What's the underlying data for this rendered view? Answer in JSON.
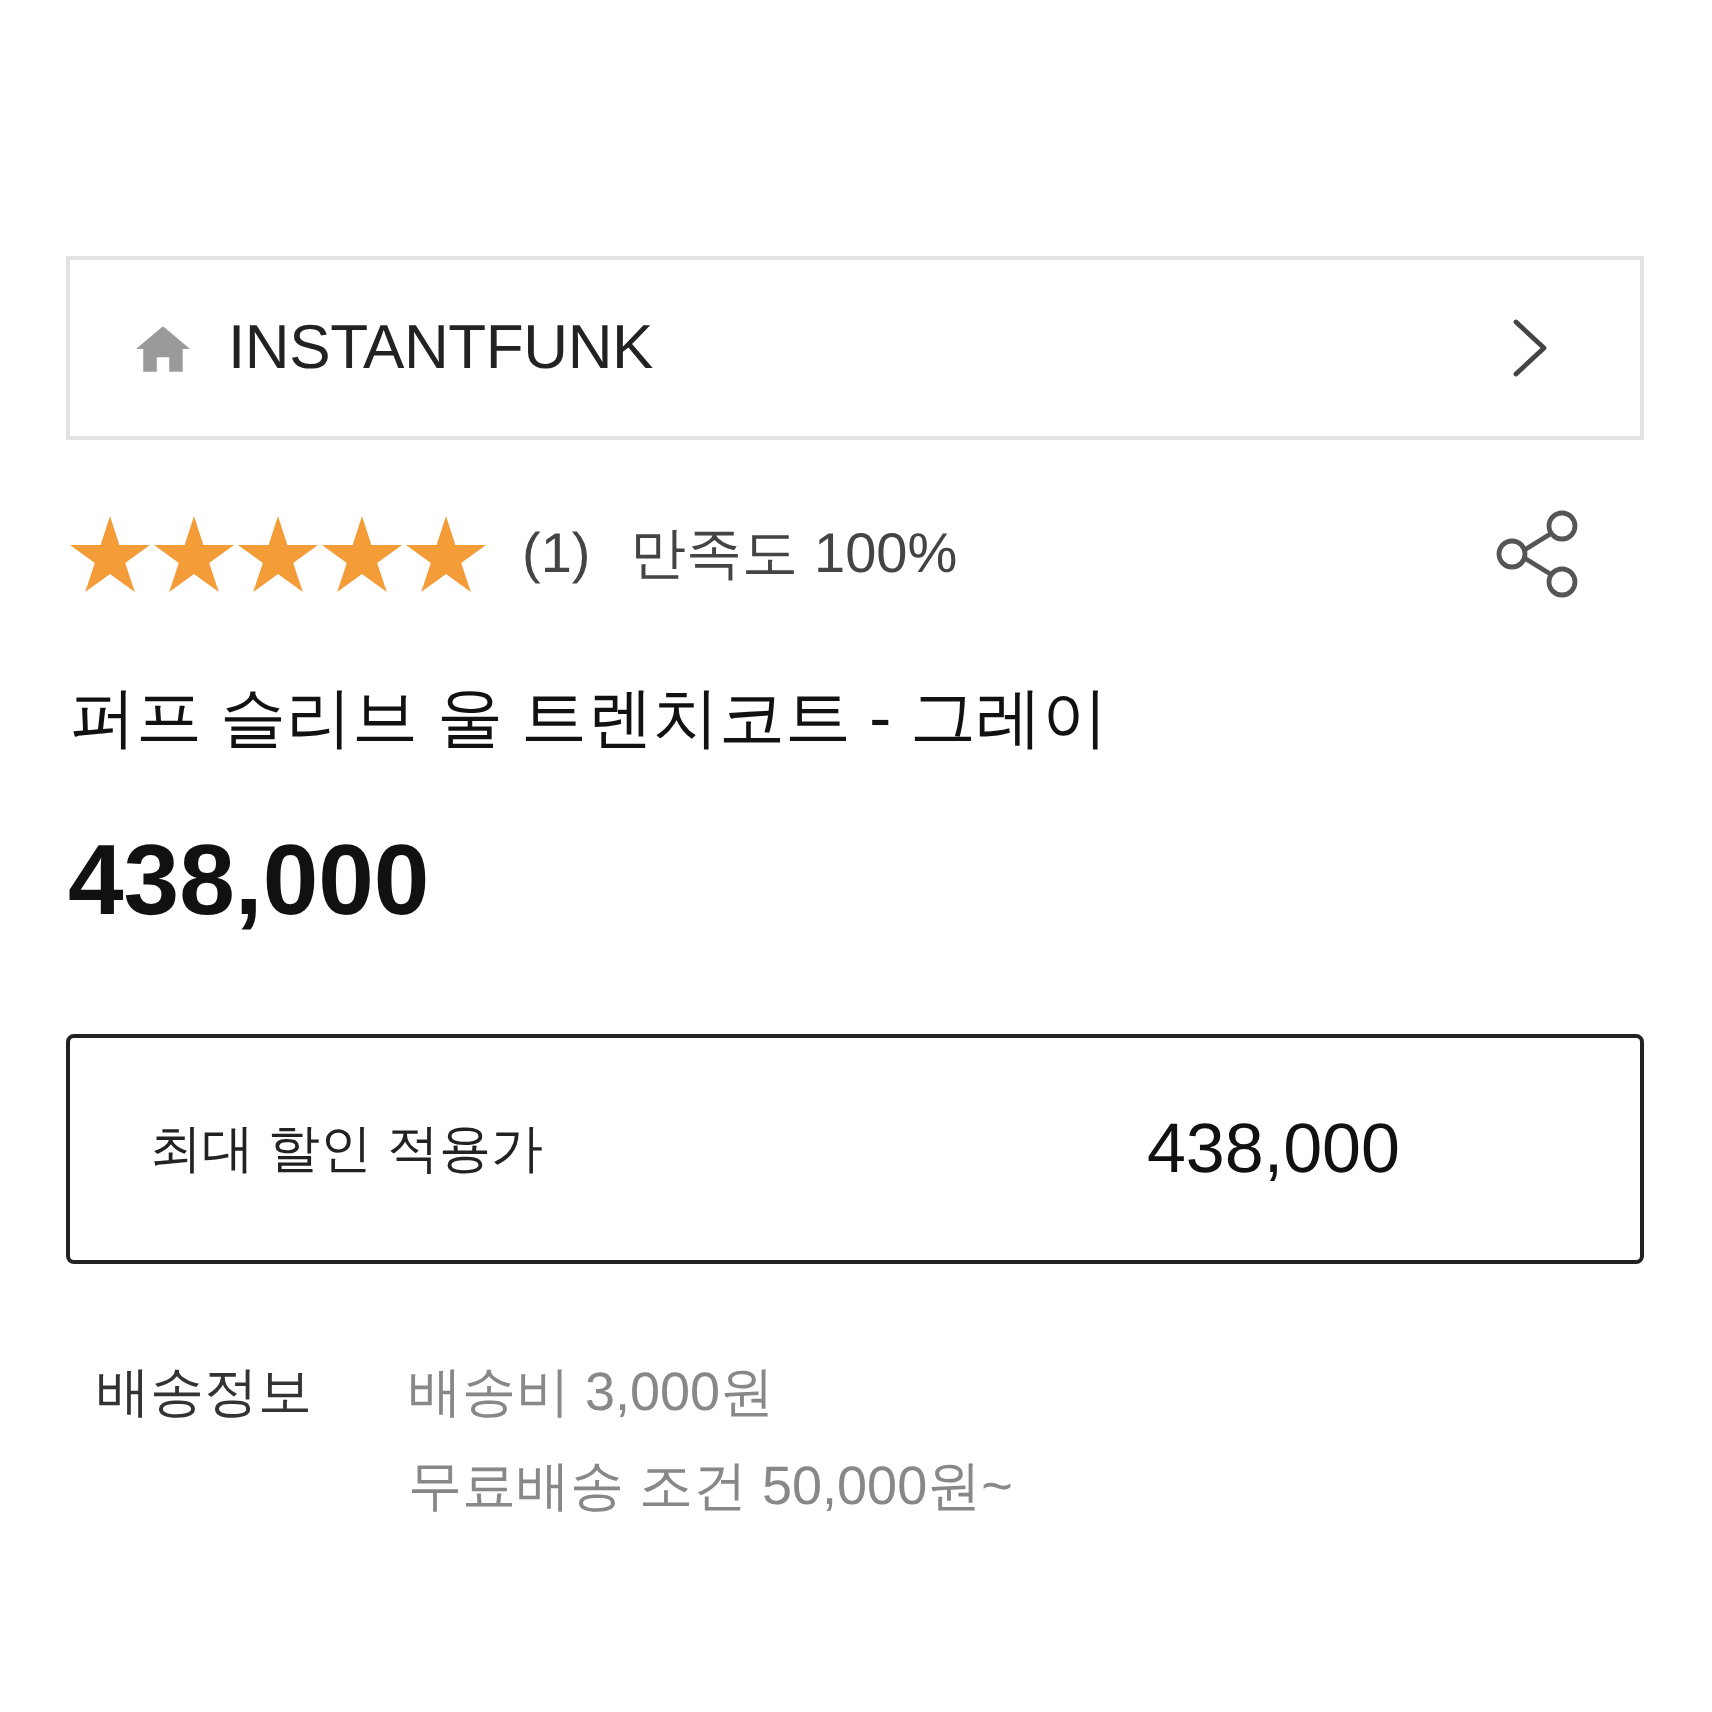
{
  "brand_bar": {
    "name": "INSTANTFUNK"
  },
  "rating": {
    "stars": 5,
    "count": "(1)",
    "satisfaction": "만족도 100%"
  },
  "product": {
    "title": "퍼프 슬리브 울 트렌치코트 - 그레이",
    "price": "438,000"
  },
  "max_discount": {
    "label": "최대 할인 적용가",
    "price": "438,000"
  },
  "shipping": {
    "label": "배송정보",
    "lines": [
      "배송비 3,000원",
      "무료배송 조건 50,000원~"
    ]
  }
}
